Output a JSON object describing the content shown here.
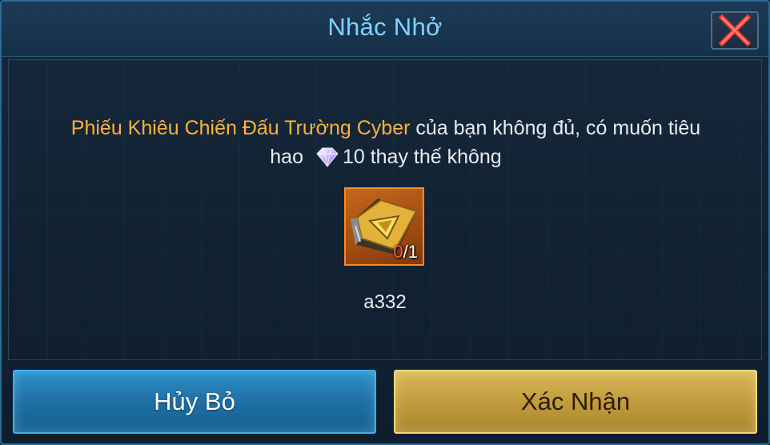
{
  "dialog": {
    "title": "Nhắc Nhở",
    "close_icon": "close-x-icon"
  },
  "message": {
    "item_highlight": "Phiếu Khiêu Chiến Đấu Trường Cyber",
    "text_part1": " của bạn không đủ, có muốn tiêu",
    "text_part2_prefix": "hao ",
    "gem_icon": "diamond-gem-icon",
    "gem_amount": "10",
    "text_part2_suffix": " thay thế không"
  },
  "item": {
    "icon": "challenge-ticket-icon",
    "have": "0",
    "need": "/1",
    "name": "a332"
  },
  "buttons": {
    "cancel_label": "Hủy Bỏ",
    "confirm_label": "Xác Nhận"
  },
  "colors": {
    "title": "#7fd3ff",
    "highlight": "#ffb23a",
    "count_insufficient": "#ff5a4a",
    "cancel_button": "#2e90c8",
    "confirm_button": "#c9a548"
  }
}
